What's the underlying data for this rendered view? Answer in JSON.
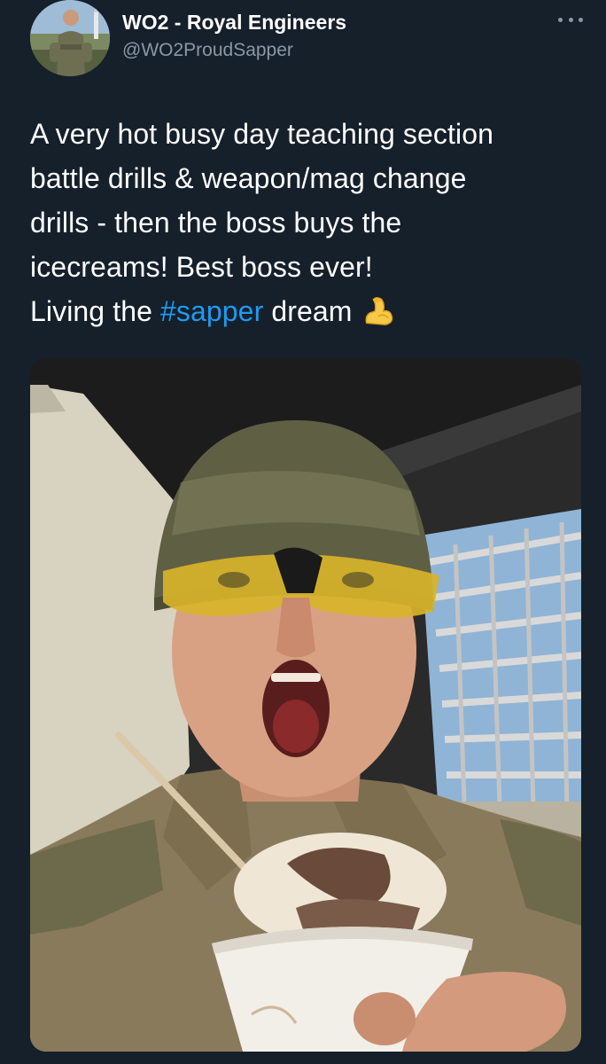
{
  "author": {
    "display_name": "WO2 - Royal Engineers",
    "handle": "@WO2ProudSapper",
    "avatar_icon": "profile-photo"
  },
  "tweet": {
    "line1": "A very hot busy day teaching section",
    "line2": "battle drills & weapon/mag change",
    "line3": "drills - then the boss buys the",
    "line4": "icecreams! Best boss ever!",
    "line5_prefix": "Living the ",
    "hashtag": "#sapper",
    "line5_suffix": " dream",
    "emoji": "flexed-biceps-emoji"
  },
  "media": {
    "type": "photo",
    "icon": "tweet-photo"
  },
  "menu": {
    "icon": "more-options-icon"
  },
  "colors": {
    "background": "#15202b",
    "text": "#ffffff",
    "secondary": "#8b98a5",
    "link": "#1d9bf0"
  }
}
